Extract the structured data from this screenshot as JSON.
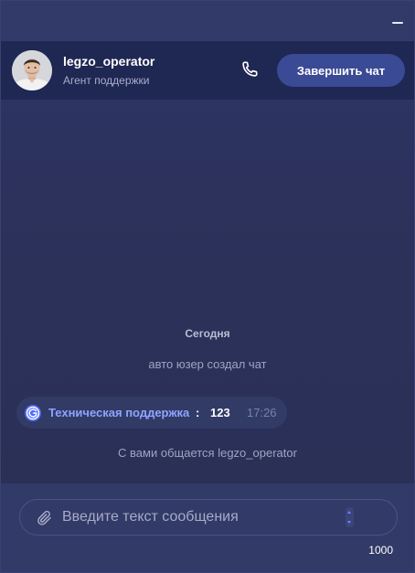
{
  "window": {
    "minimize_icon": "minimize-icon"
  },
  "operator": {
    "name": "legzo_operator",
    "role": "Агент поддержки",
    "avatar_icon": "operator-avatar"
  },
  "header": {
    "call_icon": "phone-icon",
    "end_chat_label": "Завершить чат"
  },
  "chat": {
    "day_label": "Сегодня",
    "system_created": "авто юзер создал чат",
    "message": {
      "sender": "Техническая поддержка",
      "separator": ":",
      "text": "123",
      "time": "17:26",
      "sender_icon": "support-logo-icon"
    },
    "system_connected": "С вами общается legzo_operator"
  },
  "composer": {
    "placeholder": "Введите текст сообщения",
    "value": "",
    "attach_icon": "paperclip-icon",
    "char_limit": "1000"
  },
  "colors": {
    "background": "#2b3158",
    "header": "#1f2753",
    "accent": "#3a4a95",
    "sender": "#8fa3ff"
  }
}
